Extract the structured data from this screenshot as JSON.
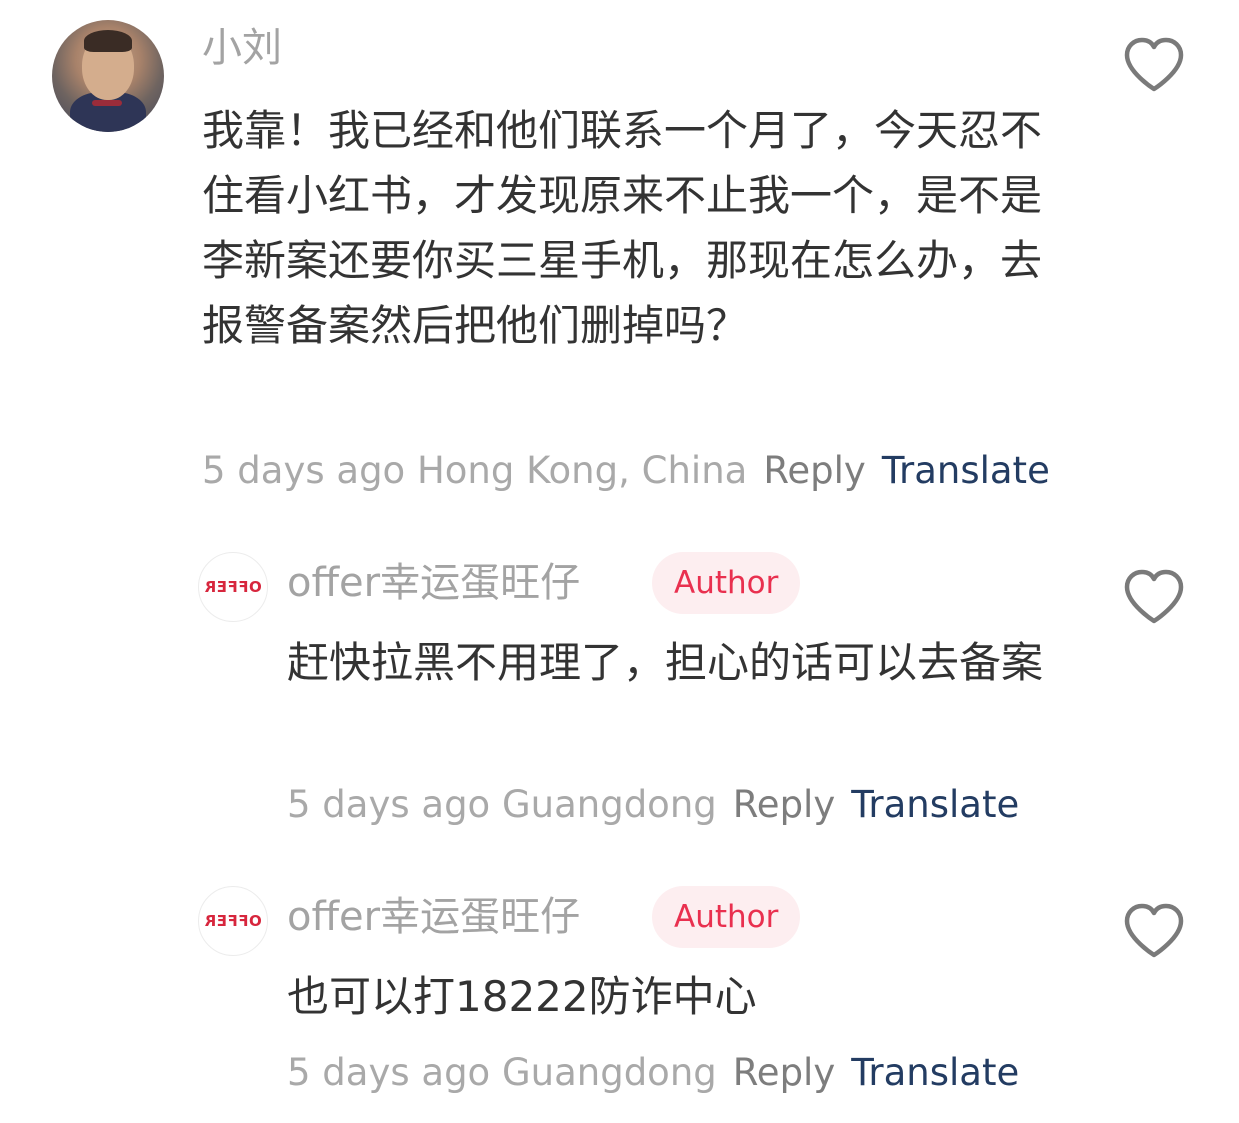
{
  "comments": [
    {
      "username": "小刘",
      "avatar_icon": "user-avatar-photo",
      "content": "我靠！我已经和他们联系一个月了，今天忍不住看小红书，才发现原来不止我一个，是不是李新案还要你买三星手机，那现在怎么办，去报警备案然后把他们删掉吗？",
      "time": "5 days ago",
      "location": "Hong Kong, China",
      "reply_label": "Reply",
      "translate_label": "Translate",
      "like_icon": "heart-outline-icon"
    },
    {
      "username": "offer幸运蛋旺仔",
      "avatar_icon": "offer-logo-avatar",
      "avatar_text": "OFFER",
      "badge": "Author",
      "content": "赶快拉黑不用理了，担心的话可以去备案",
      "time": "5 days ago",
      "location": "Guangdong",
      "reply_label": "Reply",
      "translate_label": "Translate",
      "like_icon": "heart-outline-icon"
    },
    {
      "username": "offer幸运蛋旺仔",
      "avatar_icon": "offer-logo-avatar",
      "avatar_text": "OFFER",
      "badge": "Author",
      "content": "也可以打18222防诈中心",
      "time": "5 days ago",
      "location": "Guangdong",
      "reply_label": "Reply",
      "translate_label": "Translate",
      "like_icon": "heart-outline-icon"
    }
  ],
  "colors": {
    "username": "#a3a3a3",
    "content": "#333333",
    "meta": "#a9a9a9",
    "reply": "#7d7d7d",
    "translate": "#233c62",
    "badge_text": "#e9304f",
    "badge_bg": "#fdeef0",
    "like_icon": "#7a7a7a"
  }
}
